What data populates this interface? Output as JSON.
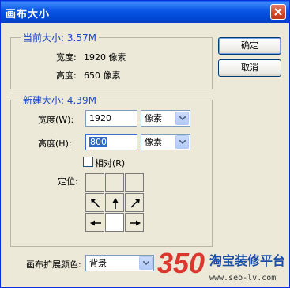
{
  "window": {
    "title": "画布大小"
  },
  "current": {
    "title": "当前大小: 3.57M",
    "width_label": "宽度:",
    "width_value": "1920 像素",
    "height_label": "高度:",
    "height_value": "650 像素"
  },
  "newsize": {
    "title": "新建大小: 4.39M",
    "width_label": "宽度(W):",
    "width_value": "1920",
    "width_unit": "像素",
    "height_label": "高度(H):",
    "height_value": "800",
    "height_unit": "像素",
    "relative_label": "相对(R)",
    "relative_checked": false,
    "anchor_label": "定位:"
  },
  "buttons": {
    "ok": "确定",
    "cancel": "取消"
  },
  "extension_color": {
    "label": "画布扩展颜色:",
    "value": "背景"
  },
  "watermark": {
    "brand": "淘宝装修平台",
    "number": "350",
    "url": "www.seo-lv.com"
  },
  "colors": {
    "title_bar": "#0a56e6",
    "group_title": "#1a47c9",
    "selection": "#316ac5",
    "watermark_red": "#d9251c",
    "watermark_blue": "#1b4ea8"
  },
  "icons": [
    "close-icon",
    "dropdown-arrow-icon",
    "arrow-up-left-icon",
    "arrow-up-icon",
    "arrow-up-right-icon",
    "arrow-left-icon",
    "arrow-right-icon"
  ]
}
